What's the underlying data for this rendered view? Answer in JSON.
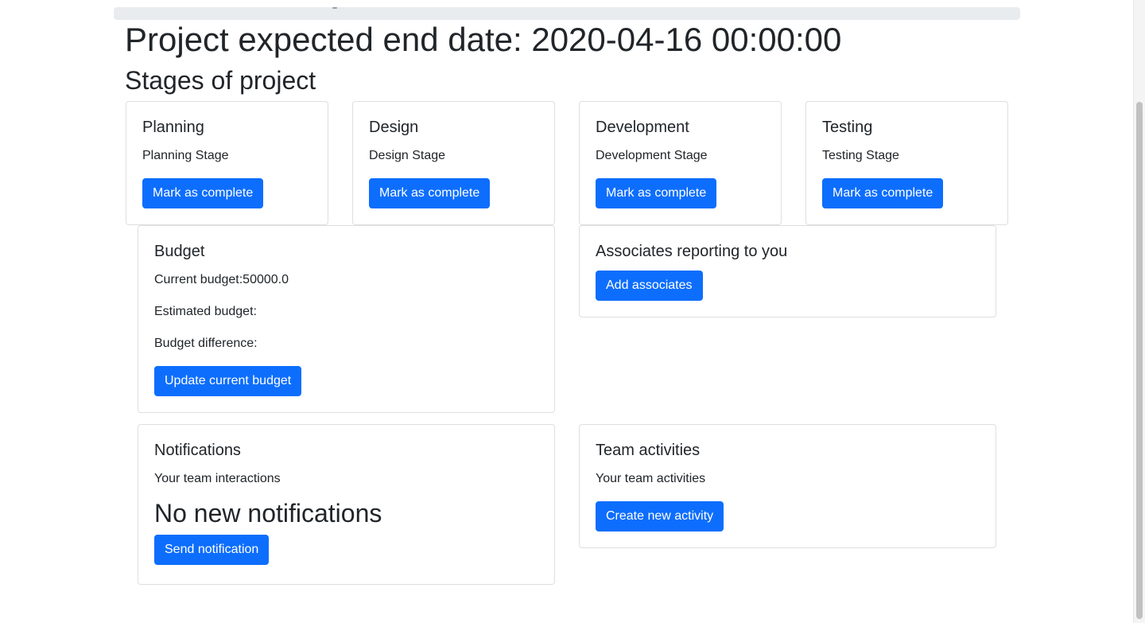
{
  "header": {
    "end_date": "Project expected end date: 2020-04-16 00:00:00",
    "stages_title": "Stages of project"
  },
  "stages": [
    {
      "title": "Planning",
      "description": "Planning Stage",
      "button": "Mark as complete"
    },
    {
      "title": "Design",
      "description": "Design Stage",
      "button": "Mark as complete"
    },
    {
      "title": "Development",
      "description": "Development Stage",
      "button": "Mark as complete"
    },
    {
      "title": "Testing",
      "description": "Testing Stage",
      "button": "Mark as complete"
    }
  ],
  "budget": {
    "title": "Budget",
    "current": "Current budget:50000.0",
    "estimated": "Estimated budget:",
    "difference": "Budget difference:",
    "button": "Update current budget"
  },
  "associates": {
    "title": "Associates reporting to you",
    "button": "Add associates"
  },
  "notifications": {
    "title": "Notifications",
    "subtitle": "Your team interactions",
    "empty_message": "No new notifications",
    "button": "Send notification"
  },
  "activities": {
    "title": "Team activities",
    "subtitle": "Your team activities",
    "button": "Create new activity"
  },
  "colors": {
    "primary": "#0d6efd",
    "text": "#212529",
    "border": "#dfdfdf",
    "top_bar": "#e9ecef"
  }
}
